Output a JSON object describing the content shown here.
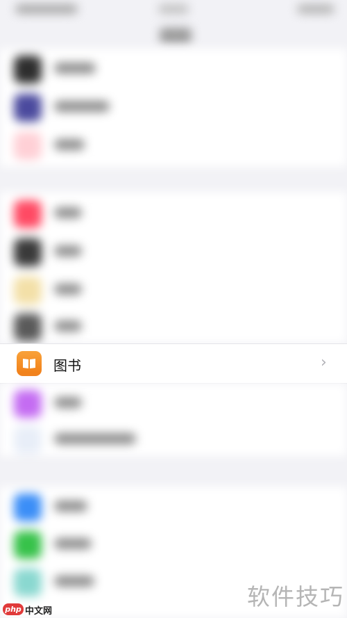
{
  "focused_row": {
    "label": "图书",
    "icon": "book-open-icon",
    "chevron": "›",
    "accent": "#f28a1f"
  },
  "watermark": {
    "text": "软件技巧",
    "logo_text": "php",
    "site_text": "中文网"
  },
  "blurred_groups": [
    {
      "rows": [
        {
          "icon_color": "#2e2e2e"
        },
        {
          "icon_color": "#4b4a9e"
        },
        {
          "icon_color": "#ff6f7a"
        }
      ]
    },
    {
      "rows": [
        {
          "icon_color": "#ff4a64"
        },
        {
          "icon_color": "#3a3a3a"
        },
        {
          "icon_color": "#f3c55c"
        },
        {
          "icon_color": "#5a5a5a"
        }
      ]
    },
    {
      "rows": [
        {
          "icon_color": "#c46cf2"
        },
        {
          "icon_color": "#6aa0f0"
        }
      ]
    },
    {
      "rows": [
        {
          "icon_color": "#3b8ef7"
        },
        {
          "icon_color": "#37c24a"
        },
        {
          "icon_color": "#8ad8d0"
        }
      ]
    }
  ]
}
